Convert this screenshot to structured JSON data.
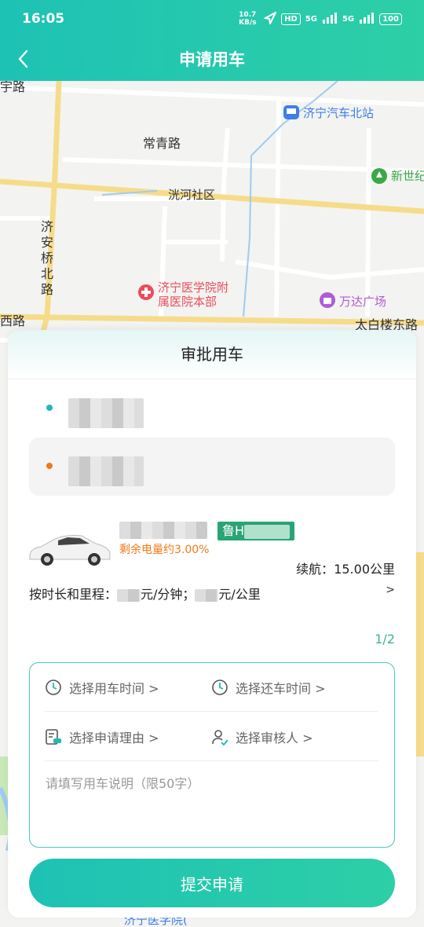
{
  "status_bar": {
    "time": "16:05",
    "speed": "10.7 KB/s",
    "hd": "HD",
    "net1": "5G",
    "net2": "5G",
    "battery": "100"
  },
  "nav": {
    "title": "申请用车",
    "back_icon": "chevron-left-icon"
  },
  "map": {
    "labels": {
      "top_road_fragment": "宇路",
      "changqing_road": "常青路",
      "jian_bei_road": "济安桥北路",
      "xihe_community": "洸河社区",
      "west_road": "西路",
      "taibai_east_road": "太白楼东路",
      "bottom_poi": "济宁医学院("
    },
    "pois": [
      {
        "name": "济宁汽车北站",
        "icon": "bus-station-icon",
        "color": "#3f7de8"
      },
      {
        "name": "新世纪",
        "icon": "park-icon",
        "color": "#3aa84a"
      },
      {
        "name": "济宁医学院附属医院本部",
        "line1": "济宁医学院附",
        "line2": "属医院本部",
        "icon": "hospital-icon",
        "color": "#e84e5b"
      },
      {
        "name": "万达广场",
        "icon": "shopping-icon",
        "color": "#b25bd6"
      }
    ]
  },
  "card": {
    "title": "审批用车",
    "pickup": {
      "dot_color": "#20b9b4",
      "icon": "pickup-dot-icon"
    },
    "return": {
      "dot_color": "#f07a18",
      "icon": "return-dot-icon"
    },
    "car": {
      "icon": "car-icon",
      "plate_prefix": "鲁H",
      "battery_text": "剩余电量约3.00%",
      "range_label": "续航：",
      "range_value": "15.00公里"
    },
    "pricing": {
      "label": "按时长和里程：",
      "per_minute": "元/分钟；",
      "per_km": "元/公里",
      "arrow": ">"
    },
    "page_indicator": "1/2",
    "form": {
      "pickup_time": "选择用车时间 >",
      "return_time": "选择还车时间 >",
      "reason": "选择申请理由 >",
      "approver": "选择审核人 >",
      "note_placeholder": "请填写用车说明（限50字）"
    },
    "submit_label": "提交申请"
  }
}
